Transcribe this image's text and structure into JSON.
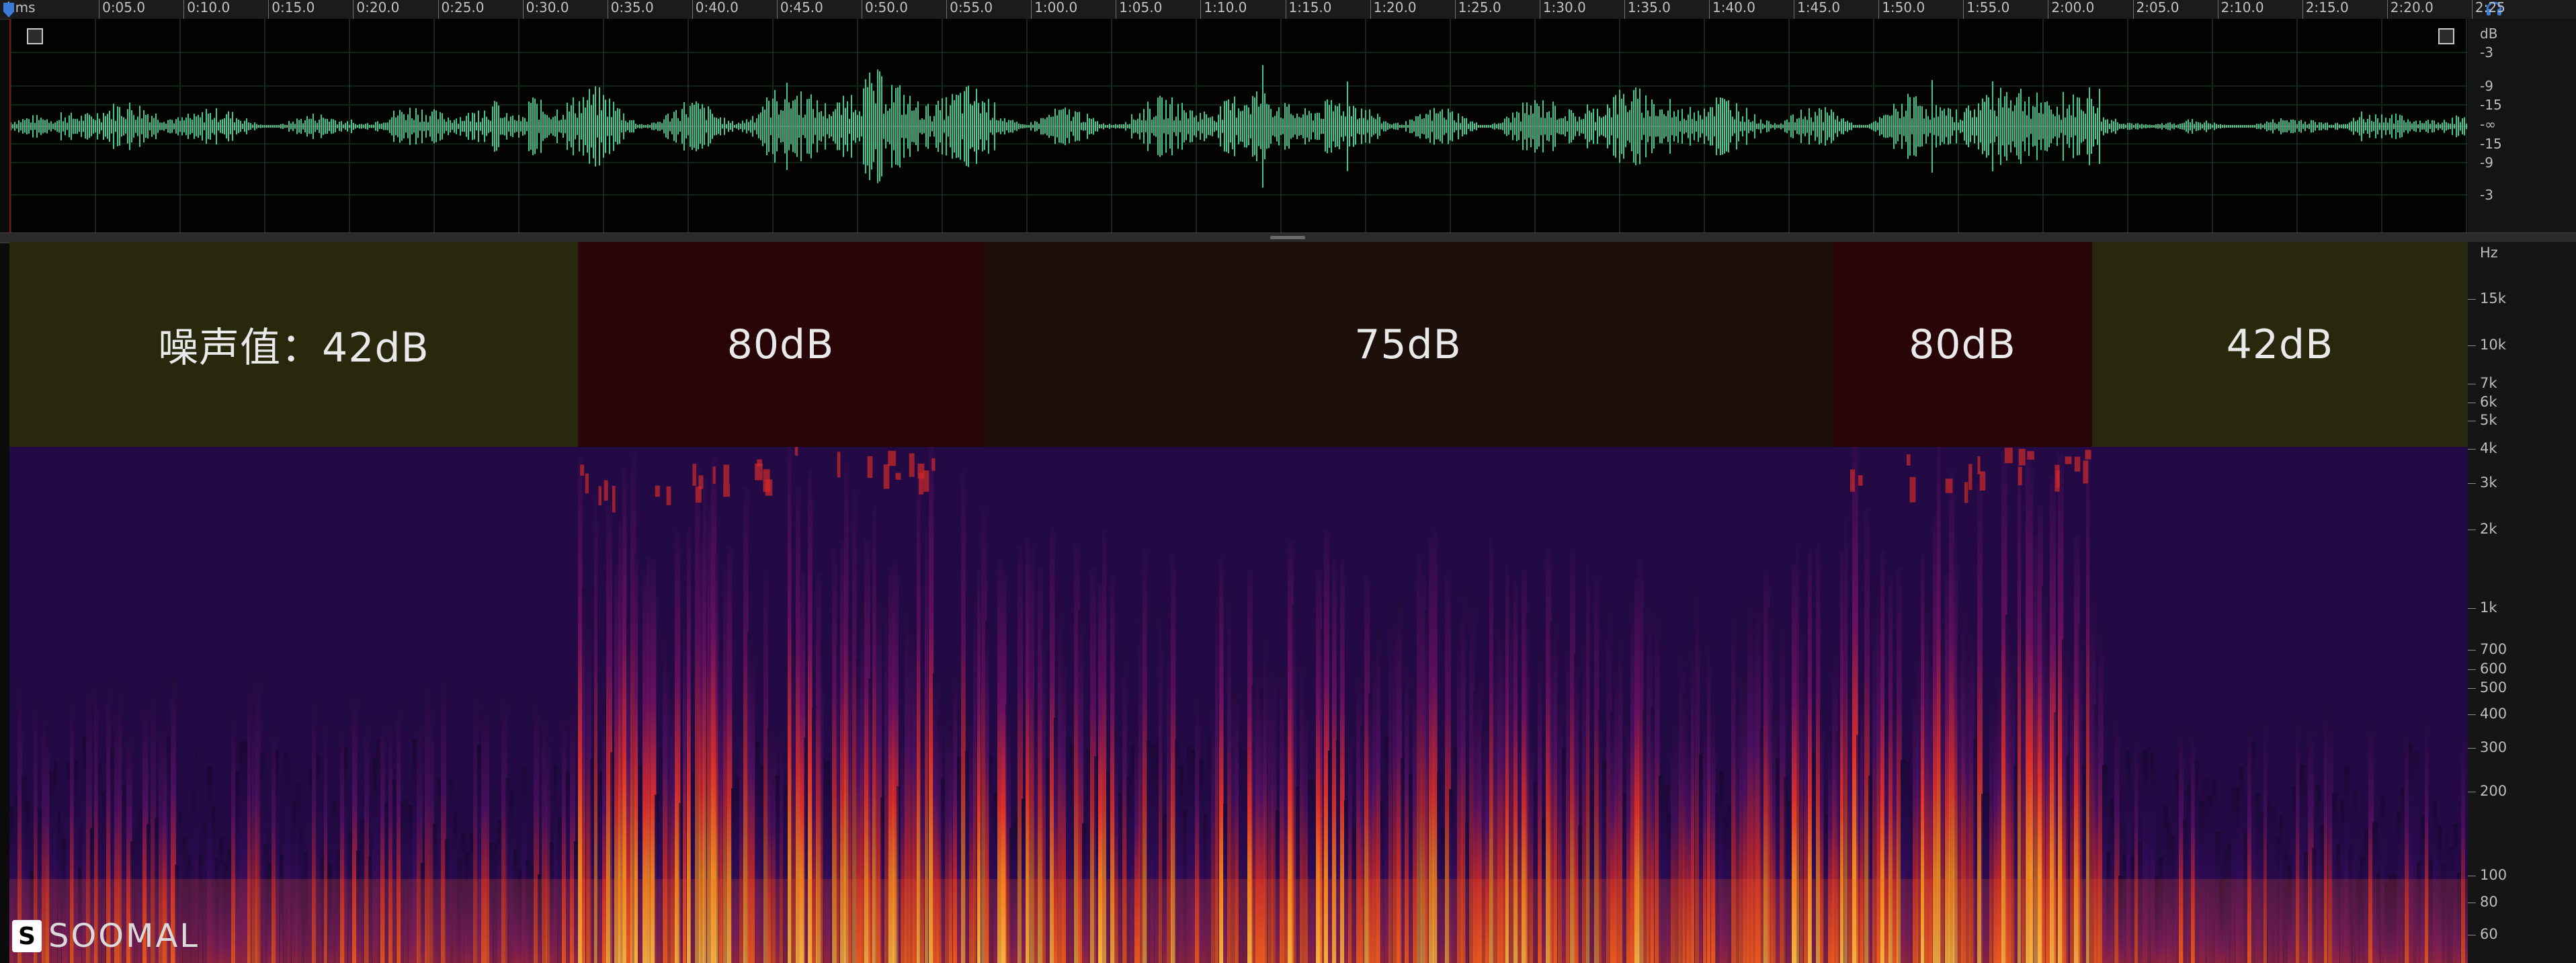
{
  "ruler": {
    "start_label": "hms",
    "labels": [
      "0:05.0",
      "0:10.0",
      "0:15.0",
      "0:20.0",
      "0:25.0",
      "0:30.0",
      "0:35.0",
      "0:40.0",
      "0:45.0",
      "0:50.0",
      "0:55.0",
      "1:00.0",
      "1:05.0",
      "1:10.0",
      "1:15.0",
      "1:20.0",
      "1:25.0",
      "1:30.0",
      "1:35.0",
      "1:40.0",
      "1:45.0",
      "1:50.0",
      "1:55.0",
      "2:00.0",
      "2:05.0",
      "2:10.0",
      "2:15.0",
      "2:20.0",
      "2:25"
    ]
  },
  "db_scale": {
    "unit": "dB",
    "labels": [
      "-3",
      "-9",
      "-15",
      "-∞",
      "-15",
      "-9",
      "-3"
    ]
  },
  "hz_scale": {
    "unit": "Hz",
    "labels": [
      "15k",
      "10k",
      "7k",
      "6k",
      "5k",
      "4k",
      "3k",
      "2k",
      "1k",
      "700",
      "600",
      "500",
      "400",
      "300",
      "200",
      "100",
      "80",
      "60"
    ]
  },
  "bands": [
    {
      "label": "噪声值：42dB",
      "color": "#27280c"
    },
    {
      "label": "80dB",
      "color": "#2a0508"
    },
    {
      "label": "75dB",
      "color": "#1d100a"
    },
    {
      "label": "80dB",
      "color": "#2a0508"
    },
    {
      "label": "42dB",
      "color": "#27280c"
    }
  ],
  "watermark": {
    "text": "SOOMAL"
  },
  "colors": {
    "waveform": "#3fc792",
    "accent": "#3a7bd5"
  },
  "icons": {
    "headphones": "headphones-icon",
    "zoom_left": "zoom-corner-icon",
    "zoom_right": "zoom-corner-icon"
  }
}
